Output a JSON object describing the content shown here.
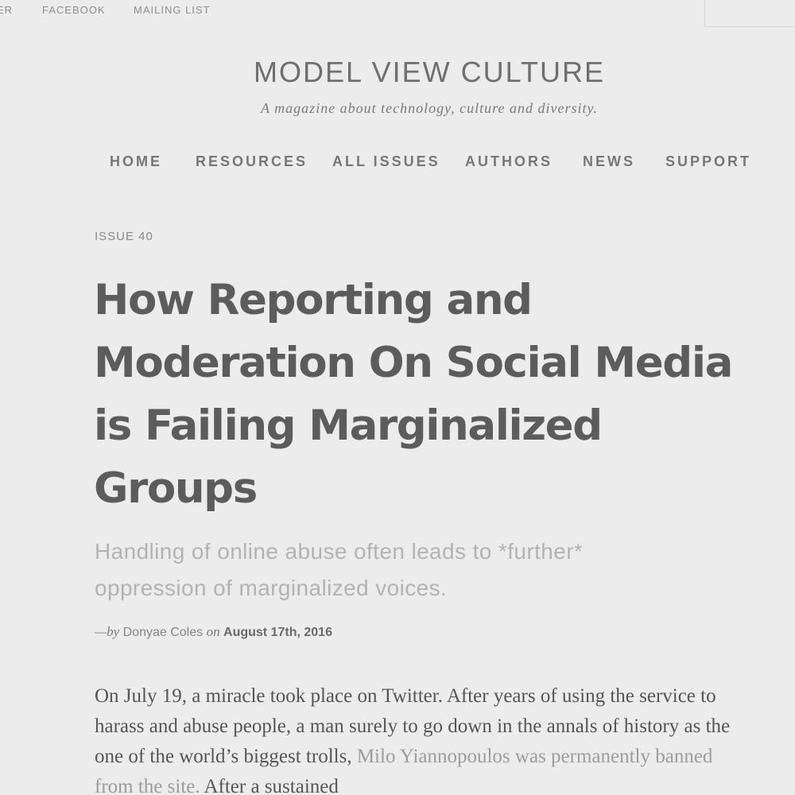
{
  "topbar": {
    "links": [
      "ER",
      "FACEBOOK",
      "MAILING LIST"
    ]
  },
  "site": {
    "title": "MODEL VIEW CULTURE",
    "tagline": "A magazine about technology, culture and diversity."
  },
  "nav": {
    "items": [
      "HOME",
      "RESOURCES",
      "ALL ISSUES",
      "AUTHORS",
      "NEWS",
      "SUPPORT"
    ]
  },
  "article": {
    "issue": "ISSUE 40",
    "title": "How Reporting and Moderation On Social Media is Failing Marginalized Groups",
    "subtitle": "Handling of online abuse often leads to *further* oppression of marginalized voices.",
    "byline": {
      "prefix": "—by",
      "author": "Donyae Coles",
      "on": "on",
      "date": "August 17th, 2016"
    },
    "body": {
      "text_before": "On July 19, a miracle took place on Twitter. After years of using the service to harass and abuse people, a man surely to go down in the annals of history as the one of the world’s biggest trolls, ",
      "link_text": "Milo Yiannopoulos was permanently banned from the site.",
      "text_after": " After a sustained"
    }
  }
}
